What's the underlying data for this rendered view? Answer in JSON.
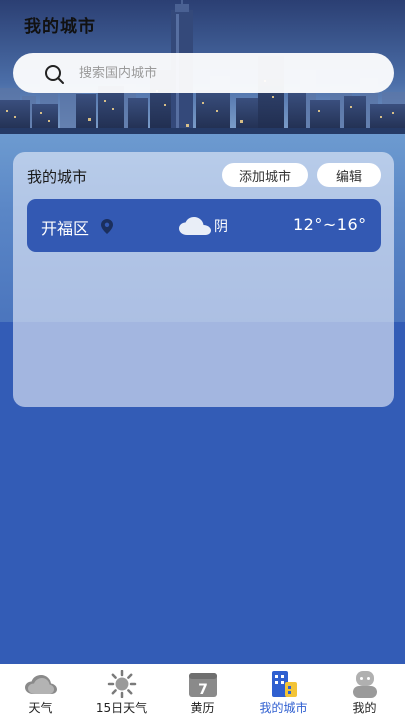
{
  "header": {
    "title": "我的城市",
    "search_placeholder": "搜索国内城市"
  },
  "card": {
    "title": "我的城市",
    "add_label": "添加城市",
    "edit_label": "编辑",
    "cities": [
      {
        "name": "开福区",
        "condition": "阴",
        "temp_range": "12°~16°",
        "icon": "cloud-icon"
      }
    ]
  },
  "tabs": [
    {
      "label": "天气",
      "icon": "cloud-icon",
      "active": false
    },
    {
      "label": "15日天气",
      "icon": "sun-icon",
      "active": false
    },
    {
      "label": "黄历",
      "icon": "calendar-icon",
      "calendar_day": "7",
      "active": false
    },
    {
      "label": "我的城市",
      "icon": "buildings-icon",
      "active": true
    },
    {
      "label": "我的",
      "icon": "user-icon",
      "active": false
    }
  ],
  "colors": {
    "primary": "#3359b3",
    "active_tab": "#2f5fd0",
    "page_bg": "#335cb6"
  }
}
